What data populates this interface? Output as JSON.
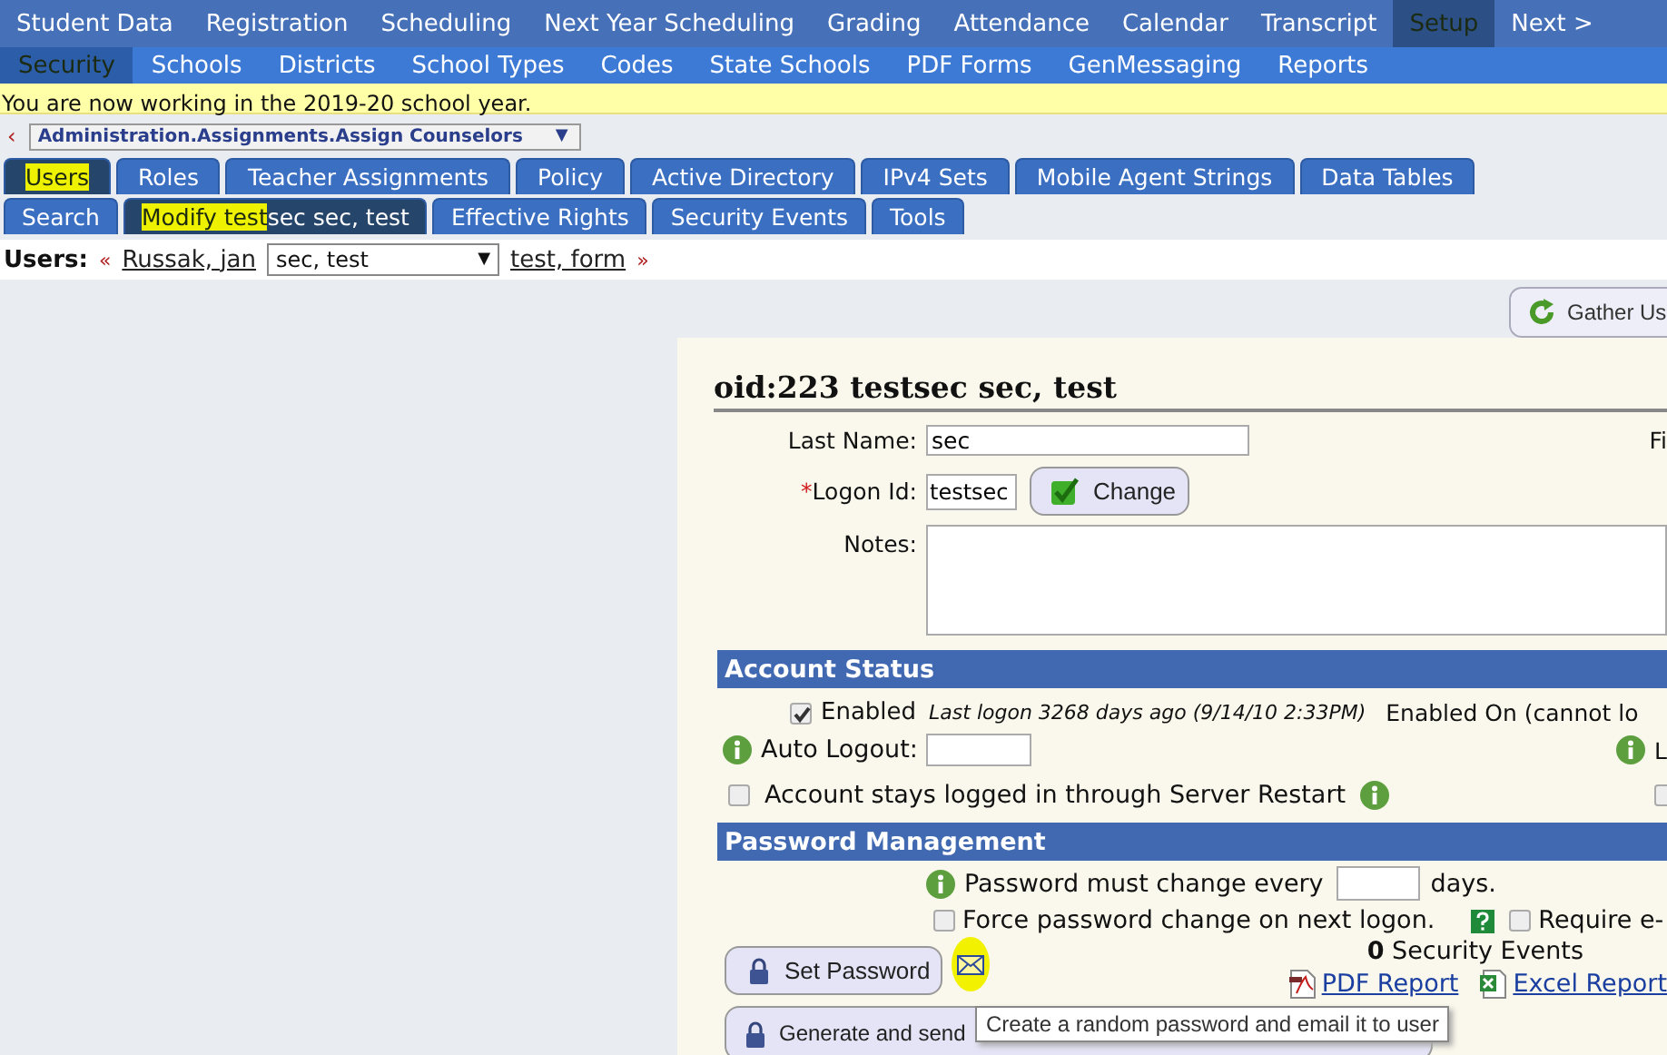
{
  "top_menu": [
    {
      "label": "Student Data",
      "selected": false,
      "highlighted": false
    },
    {
      "label": "Registration",
      "selected": false,
      "highlighted": false
    },
    {
      "label": "Scheduling",
      "selected": false,
      "highlighted": false
    },
    {
      "label": "Next Year Scheduling",
      "selected": false,
      "highlighted": false
    },
    {
      "label": "Grading",
      "selected": false,
      "highlighted": false
    },
    {
      "label": "Attendance",
      "selected": false,
      "highlighted": false
    },
    {
      "label": "Calendar",
      "selected": false,
      "highlighted": false
    },
    {
      "label": "Transcript",
      "selected": false,
      "highlighted": false
    },
    {
      "label": "Setup",
      "selected": true,
      "highlighted": true
    },
    {
      "label": "Next >",
      "selected": false,
      "highlighted": false
    }
  ],
  "sub_menu": [
    {
      "label": "Security",
      "selected": true,
      "highlighted": true
    },
    {
      "label": "Schools",
      "selected": false,
      "highlighted": false
    },
    {
      "label": "Districts",
      "selected": false,
      "highlighted": false
    },
    {
      "label": "School Types",
      "selected": false,
      "highlighted": false
    },
    {
      "label": "Codes",
      "selected": false,
      "highlighted": false
    },
    {
      "label": "State Schools",
      "selected": false,
      "highlighted": false
    },
    {
      "label": "PDF Forms",
      "selected": false,
      "highlighted": false
    },
    {
      "label": "GenMessaging",
      "selected": false,
      "highlighted": false
    },
    {
      "label": "Reports",
      "selected": false,
      "highlighted": false
    }
  ],
  "notice": "You are now working in the 2019-20 school year.",
  "breadcrumb": {
    "back": "‹",
    "value": "Administration.Assignments.Assign Counselors",
    "caret": "▼"
  },
  "tabs": [
    {
      "selected": true,
      "label_parts": [
        {
          "text": "Users",
          "highlighted": true
        }
      ]
    },
    {
      "selected": false,
      "label_parts": [
        {
          "text": "Roles",
          "highlighted": false
        }
      ]
    },
    {
      "selected": false,
      "label_parts": [
        {
          "text": "Teacher Assignments",
          "highlighted": false
        }
      ]
    },
    {
      "selected": false,
      "label_parts": [
        {
          "text": "Policy",
          "highlighted": false
        }
      ]
    },
    {
      "selected": false,
      "label_parts": [
        {
          "text": "Active Directory",
          "highlighted": false
        }
      ]
    },
    {
      "selected": false,
      "label_parts": [
        {
          "text": "IPv4 Sets",
          "highlighted": false
        }
      ]
    },
    {
      "selected": false,
      "label_parts": [
        {
          "text": "Mobile Agent Strings",
          "highlighted": false
        }
      ]
    },
    {
      "selected": false,
      "label_parts": [
        {
          "text": "Data Tables",
          "highlighted": false
        }
      ]
    }
  ],
  "subtabs": [
    {
      "selected": false,
      "label_parts": [
        {
          "text": "Search",
          "highlighted": false
        }
      ]
    },
    {
      "selected": true,
      "label_parts": [
        {
          "text": "Modify test",
          "highlighted": true
        },
        {
          "text": "sec sec, test",
          "highlighted": false
        }
      ]
    },
    {
      "selected": false,
      "label_parts": [
        {
          "text": "Effective Rights",
          "highlighted": false
        }
      ]
    },
    {
      "selected": false,
      "label_parts": [
        {
          "text": "Security Events",
          "highlighted": false
        }
      ]
    },
    {
      "selected": false,
      "label_parts": [
        {
          "text": "Tools",
          "highlighted": false
        }
      ]
    }
  ],
  "users_nav": {
    "label": "Users:",
    "prev": "«",
    "prev_user": "Russak, jan",
    "current": "sec, test",
    "caret": "▼",
    "next_user": "test, form",
    "next": "»"
  },
  "gather_button": "Gather Us",
  "record": {
    "title": "oid:223 testsec sec, test",
    "last_name_label": "Last Name:",
    "last_name": "sec",
    "right_label": "Fi",
    "logon_required": "*",
    "logon_label": "Logon Id:",
    "logon_id": "testsec",
    "change_button": "Change",
    "notes_label": "Notes:"
  },
  "account_status": {
    "header": "Account Status",
    "enabled": {
      "checked": true,
      "label": "Enabled"
    },
    "last_logon": "Last logon 3268 days ago (9/14/10 2:33PM)",
    "enabled_on": "Enabled On (cannot lo",
    "auto_logout_label": "Auto Logout:",
    "right_label": "L",
    "stays_logged": {
      "checked": false,
      "label": "Account stays logged in through Server Restart"
    },
    "right_checkbox": {
      "checked": false
    }
  },
  "password": {
    "header": "Password Management",
    "must_change_before": "Password must change every",
    "must_change_after": "days.",
    "force": {
      "checked": false,
      "label": "Force password change on next logon."
    },
    "require": {
      "checked": false,
      "label": "Require e-"
    },
    "set_password": "Set Password",
    "email_highlighted": true,
    "security_events": "**0** Security Events",
    "pdf_report": "PDF Report",
    "excel_report": "Excel Report",
    "generate": "Generate and send",
    "tooltip": "Create a random password and email it to user"
  }
}
